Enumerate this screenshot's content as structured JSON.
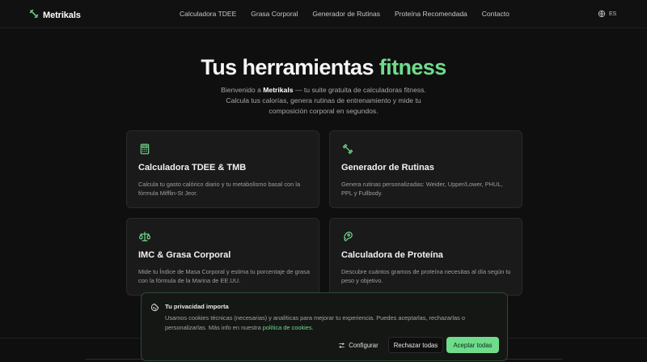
{
  "brand": {
    "name": "Metrikals",
    "accent_color": "#6fdc8c"
  },
  "nav": {
    "items": [
      "Calculadora TDEE",
      "Grasa Corporal",
      "Generador de Rutinas",
      "Proteína Recomendada",
      "Contacto"
    ]
  },
  "lang": {
    "label": "ES",
    "icon": "globe-icon"
  },
  "hero": {
    "title_main": "Tus herramientas",
    "title_accent": "fitness",
    "sub_prefix": "Bienvenido a",
    "sub_brand": "Metrikals",
    "sub_rest": "— tu suite gratuita de calculadoras fitness. Calcula tus calorías, genera rutinas de entrenamiento y mide tu composición corporal en segundos."
  },
  "cards": [
    {
      "icon": "calculator-icon",
      "title": "Calculadora TDEE & TMB",
      "desc": "Calcula tu gasto calórico diario y tu metabolismo basal con la fórmula Mifflin-St Jeor."
    },
    {
      "icon": "dumbbell-icon",
      "title": "Generador de Rutinas",
      "desc": "Genera rutinas personalizadas: Weider, Upper/Lower, PHUL, PPL y Fullbody."
    },
    {
      "icon": "scale-icon",
      "title": "IMC & Grasa Corporal",
      "desc": "Mide tu Índice de Masa Corporal y estima tu porcentaje de grasa con la fórmula de la Marina de EE.UU."
    },
    {
      "icon": "meat-icon",
      "title": "Calculadora de Proteína",
      "desc": "Descubre cuántos gramos de proteína necesitas al día según tu peso y objetivo."
    }
  ],
  "cookie": {
    "icon": "cookie-icon",
    "title": "Tu privacidad importa",
    "text": "Usamos cookies técnicas (necesarias) y analíticas para mejorar tu experiencia. Puedes aceptarlas, rechazarlas o personalizarlas. Más info en nuestra",
    "link": "política de cookies",
    "text_end": ".",
    "btn_config": "Configurar",
    "btn_reject": "Rechazar todas",
    "btn_accept": "Aceptar todas"
  }
}
